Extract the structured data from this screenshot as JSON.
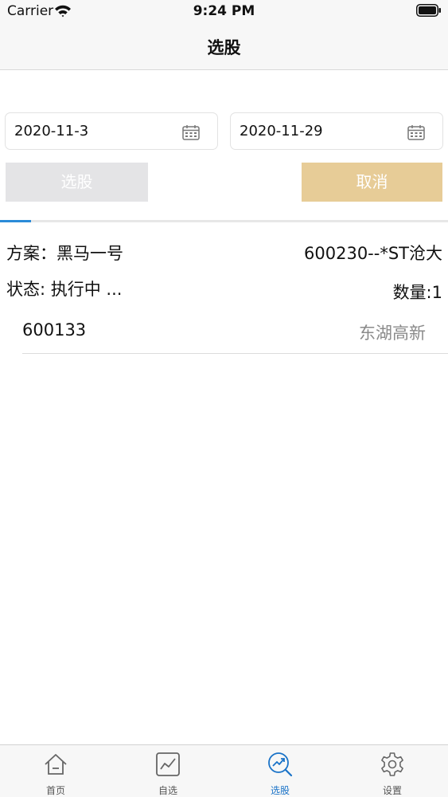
{
  "status_bar": {
    "carrier": "Carrier",
    "time": "9:24 PM"
  },
  "nav": {
    "title": "选股"
  },
  "filters": {
    "start_date": "2020-11-3",
    "end_date": "2020-11-29"
  },
  "actions": {
    "select_label": "选股",
    "cancel_label": "取消"
  },
  "progress": {
    "fraction": 0.07
  },
  "info": {
    "plan": "方案：黑马一号",
    "stock": "600230--*ST沧大",
    "status": "状态:  执行中 ...",
    "count": "数量:1"
  },
  "results": [
    {
      "code": "600133",
      "name": "东湖高新"
    }
  ],
  "tabs": [
    {
      "label": "首页",
      "icon": "home-icon"
    },
    {
      "label": "自选",
      "icon": "chart-icon"
    },
    {
      "label": "选股",
      "icon": "stock-pick-icon"
    },
    {
      "label": "设置",
      "icon": "gear-icon"
    }
  ],
  "colors": {
    "accent": "#1a73c8",
    "cancel_button": "#e7cc97",
    "select_button_disabled": "#e4e4e6",
    "progress": "#2a8bd8"
  }
}
